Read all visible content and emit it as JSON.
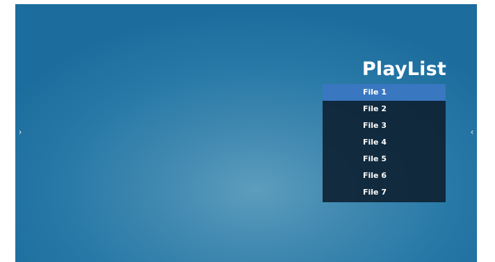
{
  "navigation": {
    "left_arrow": "›",
    "right_arrow": "‹"
  },
  "playlist": {
    "title": "PlayList",
    "selected_index": 0,
    "items": [
      {
        "label": "File 1"
      },
      {
        "label": "File 2"
      },
      {
        "label": "File 3"
      },
      {
        "label": "File 4"
      },
      {
        "label": "File 5"
      },
      {
        "label": "File 6"
      },
      {
        "label": "File 7"
      }
    ]
  },
  "colors": {
    "background": "#2a7aa8",
    "selected_item": "#3a77c1",
    "list_background": "#0c1e2d"
  }
}
